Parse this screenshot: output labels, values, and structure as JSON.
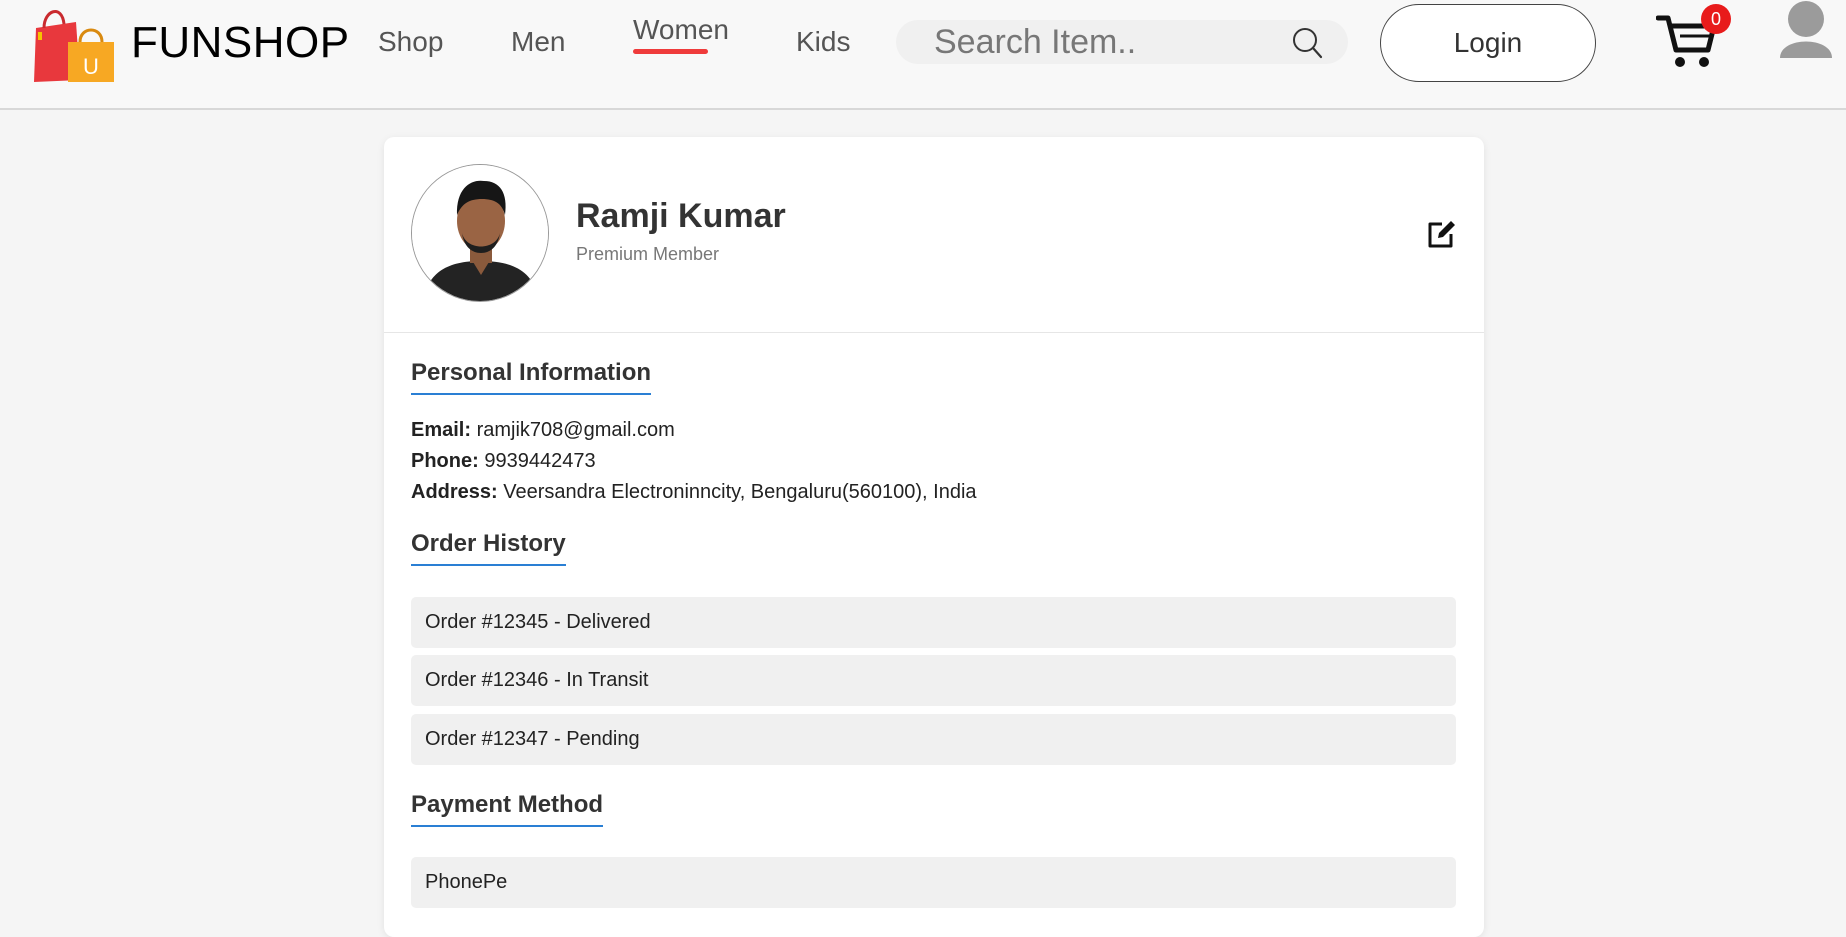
{
  "header": {
    "brand": "FUNSHOP",
    "logo_letter": "U",
    "nav": [
      "Shop",
      "Men",
      "Women",
      "Kids"
    ],
    "active_nav": "Women",
    "search_placeholder": "Search Item..",
    "login_label": "Login",
    "cart_count": "0"
  },
  "profile": {
    "name": "Ramji Kumar",
    "tier": "Premium Member"
  },
  "personal": {
    "title": "Personal Information",
    "email_label": "Email:",
    "email": "ramjik708@gmail.com",
    "phone_label": "Phone:",
    "phone": "9939442473",
    "address_label": "Address:",
    "address": "Veersandra Electroninncity, Bengaluru(560100), India"
  },
  "orders": {
    "title": "Order History",
    "items": [
      "Order #12345 - Delivered",
      "Order #12346 - In Transit",
      "Order #12347 - Pending"
    ]
  },
  "payment": {
    "title": "Payment Method",
    "method": "PhonePe"
  },
  "colors": {
    "accent": "#2a7fd4",
    "nav_underline": "#ef3b3b",
    "badge": "#e81b1b"
  }
}
